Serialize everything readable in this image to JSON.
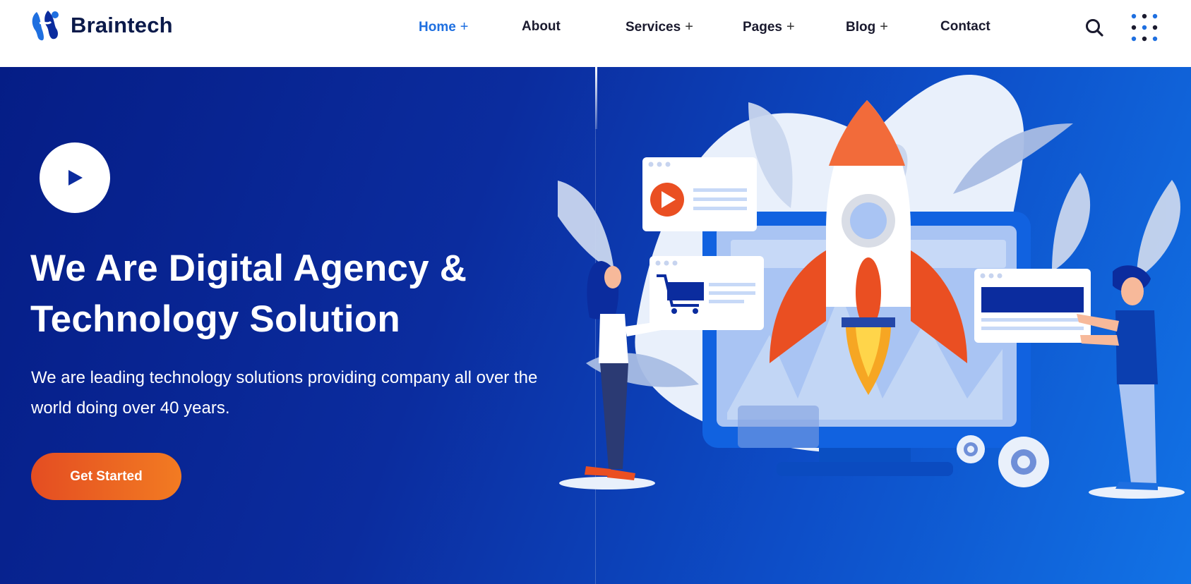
{
  "brand": {
    "name": "Braintech"
  },
  "nav": {
    "items": [
      {
        "label": "Home",
        "has_submenu": true,
        "active": true
      },
      {
        "label": "About",
        "has_submenu": false,
        "active": false
      },
      {
        "label": "Services",
        "has_submenu": true,
        "active": false
      },
      {
        "label": "Pages",
        "has_submenu": true,
        "active": false
      },
      {
        "label": "Blog",
        "has_submenu": true,
        "active": false
      },
      {
        "label": "Contact",
        "has_submenu": false,
        "active": false
      }
    ],
    "submenu_marker": "+",
    "search_icon": "search-icon",
    "menu_icon": "grid-dots-icon"
  },
  "hero": {
    "title_line1": "We Are Digital Agency &",
    "title_line2": "Technology Solution",
    "description_line1": "We are leading technology solutions providing company all over the",
    "description_line2": "world doing over 40 years.",
    "cta_label": "Get Started",
    "play_icon": "play-icon"
  },
  "colors": {
    "accent": "#1e6fe0",
    "hero_bg_start": "#051d86",
    "hero_bg_end": "#1273e6",
    "cta_start": "#e44d22",
    "cta_end": "#f27b22"
  }
}
